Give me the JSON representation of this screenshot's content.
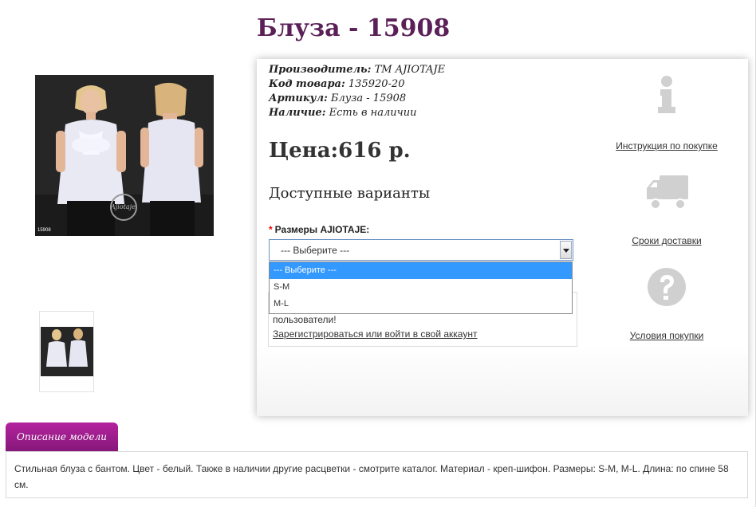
{
  "product": {
    "title": "Блуза - 15908",
    "image_code": "15908",
    "brand_watermark": "Ajiotaje"
  },
  "meta": {
    "manufacturer_label": "Производитель:",
    "manufacturer_value": "ТМ AJIOTAJE",
    "code_label": "Код товара:",
    "code_value": "135920-20",
    "article_label": "Артикул:",
    "article_value": "Блуза - 15908",
    "stock_label": "Наличие:",
    "stock_value": "Есть в наличии"
  },
  "price": "Цена:616 р.",
  "variants": {
    "title": "Доступные варианты",
    "size_label": "Размеры AJIOTAJE:",
    "required_mark": "*",
    "selected": "--- Выберите ---",
    "options": [
      "--- Выберите ---",
      "S-M",
      "M-L"
    ]
  },
  "login": {
    "hint": "пользователи!",
    "link": "Зарегистрироваться или войти в свой аккаунт"
  },
  "side": {
    "instruction": "Инструкция по покупке",
    "delivery": "Сроки доставки",
    "terms": "Условия покупки"
  },
  "description": {
    "tab_label": "Описание модели",
    "text": "Стильная блуза с бантом. Цвет - белый. Также в наличии другие расцветки - смотрите каталог. Материал - креп-шифон. Размеры: S-M, M-L. Длина: по спине 58 см."
  },
  "colors": {
    "title": "#5b2058",
    "tab": "#a01e8f",
    "icon_grey": "#d0d0d0",
    "option_highlight": "#3399ff"
  }
}
